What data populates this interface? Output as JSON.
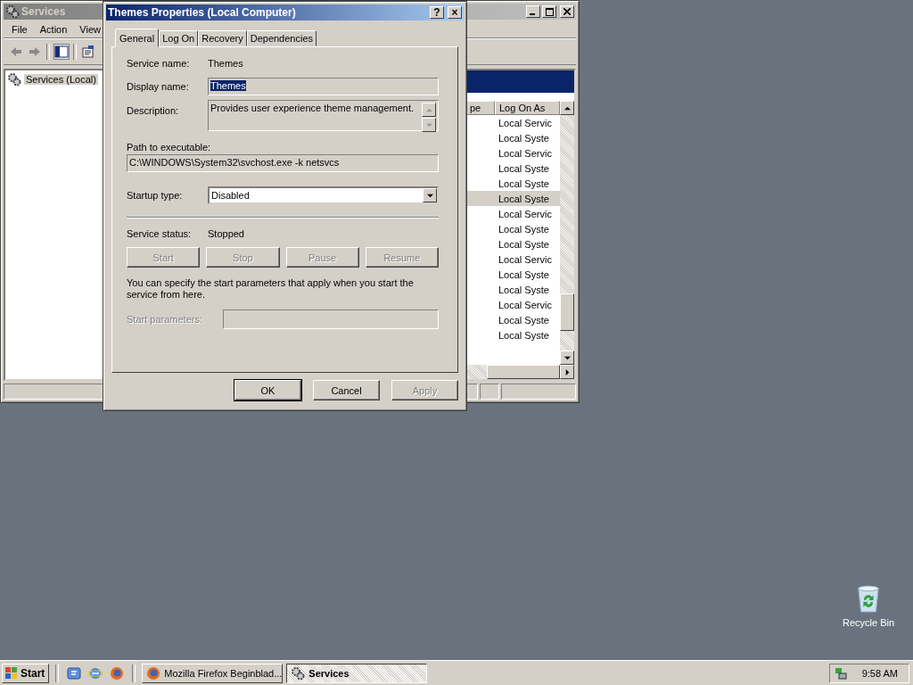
{
  "services_window": {
    "title": "Services",
    "menu": [
      "File",
      "Action",
      "View"
    ],
    "tree": {
      "label": "Services (Local)"
    },
    "columns": [
      "pe",
      "Log On As"
    ],
    "rows": [
      {
        "log_on_as": "Local Servic",
        "selected": false
      },
      {
        "log_on_as": "Local Syste",
        "selected": false
      },
      {
        "log_on_as": "Local Servic",
        "selected": false
      },
      {
        "log_on_as": "Local Syste",
        "selected": false
      },
      {
        "log_on_as": "Local Syste",
        "selected": false
      },
      {
        "log_on_as": "Local Syste",
        "selected": true
      },
      {
        "log_on_as": "Local Servic",
        "selected": false
      },
      {
        "log_on_as": "Local Syste",
        "selected": false
      },
      {
        "log_on_as": "Local Syste",
        "selected": false
      },
      {
        "log_on_as": "Local Servic",
        "selected": false
      },
      {
        "log_on_as": "Local Syste",
        "selected": false
      },
      {
        "log_on_as": "Local Syste",
        "selected": false
      },
      {
        "log_on_as": "Local Servic",
        "selected": false
      },
      {
        "log_on_as": "Local Syste",
        "selected": false
      },
      {
        "log_on_as": "Local Syste",
        "selected": false
      }
    ]
  },
  "dialog": {
    "title": "Themes Properties (Local Computer)",
    "help_button": "?",
    "close_button": "×",
    "tabs": [
      {
        "label": "General",
        "selected": true
      },
      {
        "label": "Log On",
        "selected": false
      },
      {
        "label": "Recovery",
        "selected": false
      },
      {
        "label": "Dependencies",
        "selected": false
      }
    ],
    "service_name": {
      "label": "Service name:",
      "value": "Themes"
    },
    "display_name": {
      "label": "Display name:",
      "value": "Themes",
      "highlighted": true
    },
    "description": {
      "label": "Description:",
      "value": "Provides user experience theme management."
    },
    "path": {
      "label": "Path to executable:",
      "value": "C:\\WINDOWS\\System32\\svchost.exe -k netsvcs"
    },
    "startup_type": {
      "label": "Startup type:",
      "value": "Disabled"
    },
    "service_status": {
      "label": "Service status:",
      "value": "Stopped"
    },
    "service_buttons": [
      {
        "label": "Start",
        "disabled": true
      },
      {
        "label": "Stop",
        "disabled": true
      },
      {
        "label": "Pause",
        "disabled": true
      },
      {
        "label": "Resume",
        "disabled": true
      }
    ],
    "hint": "You can specify the start parameters that apply when you start the service from here.",
    "start_parameters": {
      "label": "Start parameters:",
      "disabled": true
    },
    "buttons": [
      {
        "label": "OK",
        "disabled": false
      },
      {
        "label": "Cancel",
        "disabled": false
      },
      {
        "label": "Apply",
        "disabled": true
      }
    ]
  },
  "desktop_icons": [
    {
      "label": "Recycle Bin"
    }
  ],
  "taskbar": {
    "start": "Start",
    "tasks": [
      {
        "label": "Mozilla Firefox Beginblad...",
        "kind": "firefox",
        "selected": false
      },
      {
        "label": "Services",
        "kind": "services",
        "selected": true
      }
    ],
    "clock": "9:58 AM"
  }
}
